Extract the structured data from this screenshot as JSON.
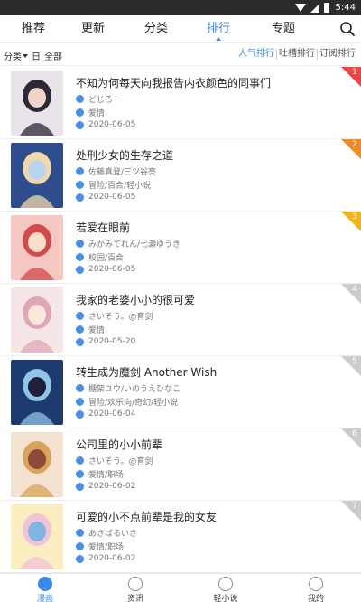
{
  "status": {
    "time": "5:44"
  },
  "tabs": [
    {
      "label": "推荐",
      "active": false
    },
    {
      "label": "更新",
      "active": false
    },
    {
      "label": "分类",
      "active": false
    },
    {
      "label": "排行",
      "active": true
    },
    {
      "label": "专题",
      "active": false
    }
  ],
  "filters": {
    "category": "分类",
    "period": "日",
    "scope": "全部"
  },
  "ranking_types": [
    {
      "label": "人气排行",
      "active": true
    },
    {
      "label": "吐槽排行",
      "active": false
    },
    {
      "label": "订阅排行",
      "active": false
    }
  ],
  "items": [
    {
      "rank": "1",
      "title": "不知为何每天向我报告内衣颜色的同事们",
      "author": "どじろー",
      "tags": "爱情",
      "date": "2020-06-05",
      "badge_color": "#ee4444",
      "cover_colors": [
        "#e9e4ea",
        "#2d2838",
        "#f2d5c8"
      ]
    },
    {
      "rank": "2",
      "title": "处刑少女的生存之道",
      "author": "佐藤真登/三ツ谷亮",
      "tags": "冒险/百合/轻小说",
      "date": "2020-06-05",
      "badge_color": "#f08a24",
      "cover_colors": [
        "#2f4d8c",
        "#f0d8a8",
        "#b9d4f0"
      ]
    },
    {
      "rank": "3",
      "title": "若爱在眼前",
      "author": "みかみてれん/七瀬ゆうき",
      "tags": "校园/百合",
      "date": "2020-06-05",
      "badge_color": "#f2b518",
      "cover_colors": [
        "#f4c7c2",
        "#d24a4a",
        "#f6e0cc"
      ]
    },
    {
      "rank": "4",
      "title": "我家的老婆小小的很可爱",
      "author": "さいそう。@育剑",
      "tags": "爱情",
      "date": "2020-05-20",
      "badge_color": "#cccccc",
      "cover_colors": [
        "#f5e6e8",
        "#e0a6b8",
        "#fbe9d9"
      ]
    },
    {
      "rank": "5",
      "title": "转生成为魔剑 Another Wish",
      "author": "棚架ユウ/いのうえひなこ",
      "tags": "冒险/欢乐向/奇幻/轻小说",
      "date": "2020-06-04",
      "badge_color": "#cccccc",
      "cover_colors": [
        "#1d3b6e",
        "#8fc6e8",
        "#1f1f3a"
      ]
    },
    {
      "rank": "6",
      "title": "公司里的小小前辈",
      "author": "さいそう。@育剑",
      "tags": "爱情/职场",
      "date": "2020-06-02",
      "badge_color": "#cccccc",
      "cover_colors": [
        "#f3e2cf",
        "#d9a35c",
        "#8c4a3a"
      ]
    },
    {
      "rank": "7",
      "title": "可爱的小不点前辈是我的女友",
      "author": "あきばるいき",
      "tags": "爱情/职场",
      "date": "2020-06-02",
      "badge_color": "#cccccc",
      "cover_colors": [
        "#fbeec0",
        "#f2c2d6",
        "#7fb5e0"
      ]
    }
  ],
  "bottom_nav": [
    {
      "label": "漫画",
      "active": true
    },
    {
      "label": "资讯",
      "active": false
    },
    {
      "label": "轻小说",
      "active": false
    },
    {
      "label": "我的",
      "active": false
    }
  ]
}
